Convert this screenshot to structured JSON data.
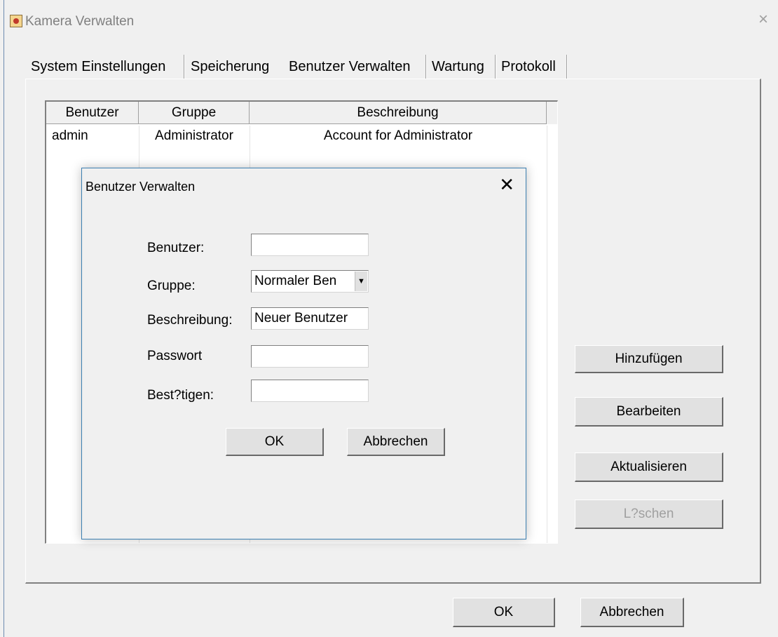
{
  "window": {
    "title": "Kamera Verwalten",
    "close_glyph": "×"
  },
  "tabs": [
    {
      "label": "System Einstellungen"
    },
    {
      "label": "Speicherung"
    },
    {
      "label": "Benutzer Verwalten"
    },
    {
      "label": "Wartung"
    },
    {
      "label": "Protokoll"
    }
  ],
  "active_tab": "Benutzer Verwalten",
  "user_list": {
    "columns": [
      "Benutzer",
      "Gruppe",
      "Beschreibung"
    ],
    "rows": [
      {
        "user": "admin",
        "group": "Administrator",
        "description": "Account for Administrator"
      }
    ]
  },
  "side_buttons": {
    "add": "Hinzufügen",
    "edit": "Bearbeiten",
    "refresh": "Aktualisieren",
    "delete": "L?schen"
  },
  "footer": {
    "ok": "OK",
    "cancel": "Abbrechen"
  },
  "dialog": {
    "title": "Benutzer Verwalten",
    "close_glyph": "✕",
    "fields": {
      "user_label": "Benutzer:",
      "user_value": "",
      "group_label": "Gruppe:",
      "group_value": "Normaler Ben",
      "description_label": "Beschreibung:",
      "description_value": "Neuer Benutzer",
      "password_label": "Passwort",
      "password_value": "",
      "confirm_label": "Best?tigen:",
      "confirm_value": ""
    },
    "ok": "OK",
    "cancel": "Abbrechen"
  },
  "icons": {
    "window": "camera-app-icon",
    "dropdown": "chevron-down-icon"
  }
}
